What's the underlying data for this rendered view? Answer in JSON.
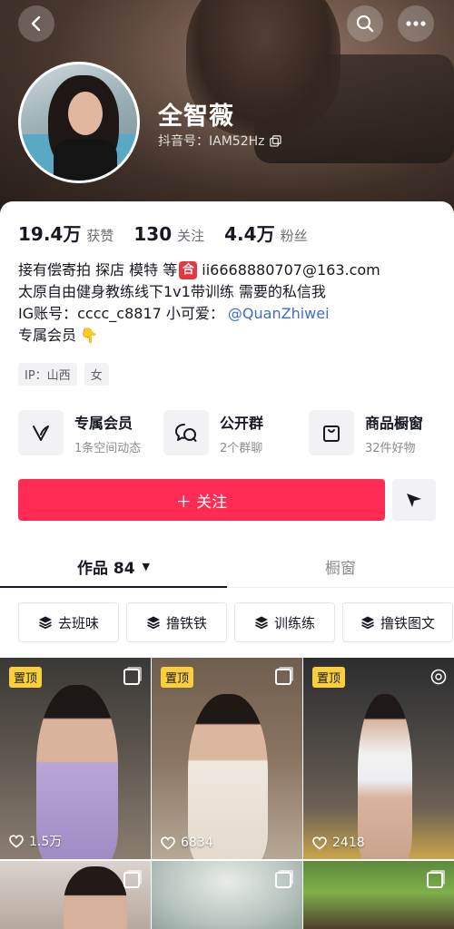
{
  "profile": {
    "name": "全智薇",
    "douyin_id": "抖音号：IAM52Hz"
  },
  "stats": [
    {
      "value": "19.4万",
      "label": "获赞"
    },
    {
      "value": "130",
      "label": "关注"
    },
    {
      "value": "4.4万",
      "label": "粉丝"
    }
  ],
  "bio": {
    "line1_text": "接有偿寄拍 探店 模特 等",
    "line1_tag": "合",
    "line1_email": "ii6668880707@163.com",
    "line2": "太原自由健身教练线下1v1带训练 需要的私信我",
    "line3_prefix": "IG账号：cccc_c8817 小可爱：",
    "line3_link": "@QuanZhiwei",
    "line4": "专属会员"
  },
  "tags": [
    "IP：山西",
    "女"
  ],
  "features": [
    {
      "title": "专属会员",
      "sub": "1条空间动态",
      "icon": "vip-v-icon"
    },
    {
      "title": "公开群",
      "sub": "2个群聊",
      "icon": "group-chat-icon"
    },
    {
      "title": "商品橱窗",
      "sub": "32件好物",
      "icon": "shopping-bag-icon"
    }
  ],
  "actions": {
    "follow": "＋ 关注"
  },
  "tabs": [
    {
      "label": "作品 84"
    },
    {
      "label": "橱窗"
    }
  ],
  "collections": [
    "去班味",
    "撸铁铁",
    "训练练",
    "撸铁图文"
  ],
  "grid": [
    {
      "pinned": "置顶",
      "likes": "1.5万"
    },
    {
      "pinned": "置顶",
      "likes": "6834"
    },
    {
      "pinned": "置顶",
      "likes": "2418"
    }
  ],
  "colors": {
    "accent": "#fe2c55",
    "pin_badge": "#facf3b",
    "link": "#3f6ec4"
  }
}
